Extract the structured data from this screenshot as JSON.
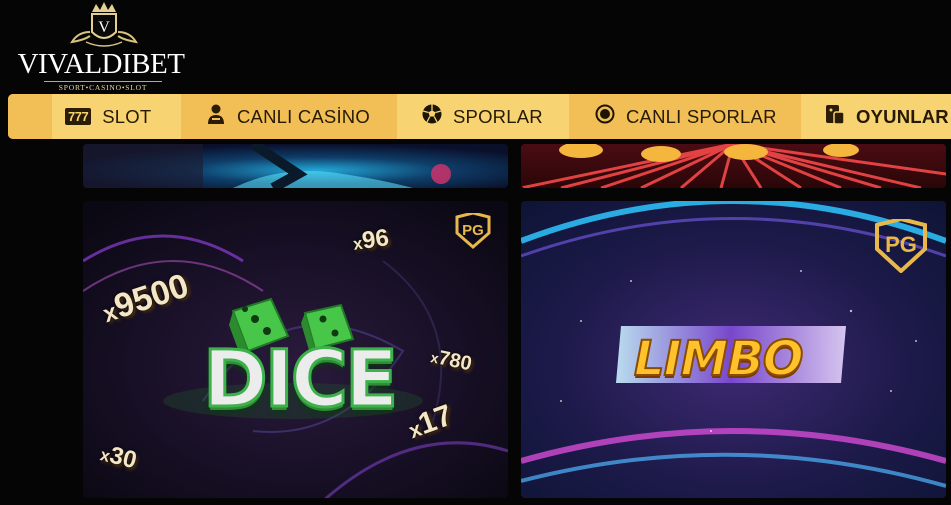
{
  "brand": {
    "name": "VIVALDIBET",
    "tagline": "SPORT•CASINO•SLOT",
    "crest_letter": "V"
  },
  "nav": {
    "items": [
      {
        "label": "SLOT",
        "icon": "slot-777-icon"
      },
      {
        "label": "CANLI CASİNO",
        "icon": "dealer-icon"
      },
      {
        "label": "SPORLAR",
        "icon": "soccer-ball-icon"
      },
      {
        "label": "CANLI SPORLAR",
        "icon": "live-dot-icon"
      },
      {
        "label": "OYUNLAR",
        "icon": "games-icon"
      }
    ],
    "slot_icon_text": "777"
  },
  "games": {
    "dice": {
      "title": "DICE",
      "provider": "PG",
      "multipliers": [
        {
          "prefix": "x",
          "value": "96"
        },
        {
          "prefix": "x",
          "value": "9500"
        },
        {
          "prefix": "x",
          "value": "780"
        },
        {
          "prefix": "x",
          "value": "17"
        },
        {
          "prefix": "x",
          "value": "30"
        }
      ]
    },
    "limbo": {
      "title": "LIMBO",
      "provider": "PG"
    }
  },
  "colors": {
    "nav_bg": "#f3c15a",
    "nav_alt": "#f8d371",
    "page_bg": "#060505",
    "dice_green": "#3bb24a",
    "limbo_gold": "#ffc22b"
  }
}
